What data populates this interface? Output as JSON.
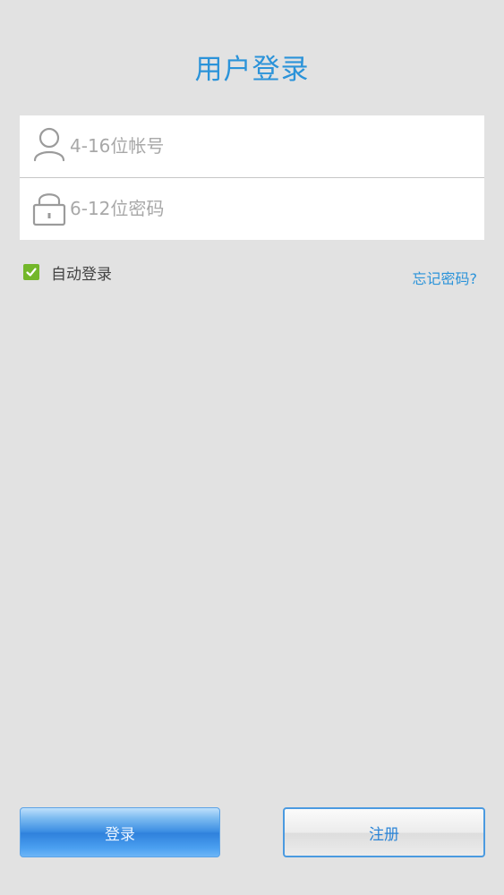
{
  "header": {
    "title": "用户登录"
  },
  "form": {
    "username_placeholder": "4-16位帐号",
    "username_value": "",
    "password_placeholder": "6-12位密码",
    "password_value": ""
  },
  "options": {
    "auto_login_label": "自动登录",
    "auto_login_checked": true,
    "forgot_password_label": "忘记密码?"
  },
  "actions": {
    "login_label": "登录",
    "register_label": "注册"
  },
  "colors": {
    "accent": "#2b93d9",
    "checkbox": "#73b72a",
    "background": "#e2e2e2"
  },
  "icons": {
    "username": "user-icon",
    "password": "lock-icon",
    "checkbox": "checkmark-icon"
  }
}
